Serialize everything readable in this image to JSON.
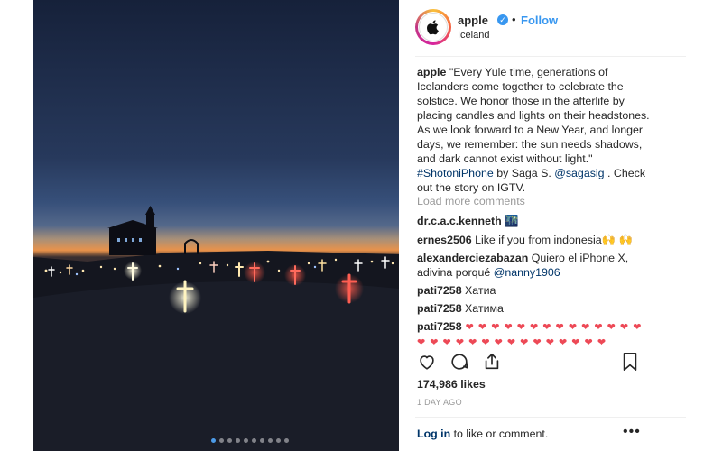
{
  "post": {
    "username": "apple",
    "verified_mark": "✓",
    "bullet": "•",
    "follow_label": "Follow",
    "location": "Iceland",
    "caption": {
      "user": "apple",
      "text": "\"Every Yule time, generations of Icelanders come together to celebrate the solstice. We honor those in the afterlife by placing candles and lights on their headstones. As we look forward to a New Year, and longer days, we remember: the sun needs shadows, and dark cannot exist without light.\" ",
      "hashtag": "#ShotoniPhone",
      "by_text": " by Saga S. ",
      "mention": "@sagasig",
      "tail": " . Check out the story on IGTV."
    },
    "load_more": "Load more comments",
    "comments": [
      {
        "user": "dr.c.a.c.kenneth",
        "text": " 🌃"
      },
      {
        "user": "ernes2506",
        "text": " Like if you from indonesia🙌 🙌"
      },
      {
        "user": "alexanderciezabazan",
        "text": " Quiero el iPhone X, adivina porqué ",
        "mention": "@nanny1906"
      },
      {
        "user": "pati7258",
        "text": " Хатиа"
      },
      {
        "user": "pati7258",
        "text": " Хатима"
      },
      {
        "user": "pati7258",
        "hearts_line1": " ❤ ❤ ❤ ❤ ❤ ❤ ❤ ❤ ❤ ❤ ❤ ❤ ❤ ❤",
        "hearts_line2": "❤ ❤ ❤ ❤ ❤ ❤ ❤ ❤ ❤ ❤ ❤ ❤ ❤ ❤ ❤"
      }
    ],
    "likes": "174,986 likes",
    "date": "1 DAY AGO",
    "login_link": "Log in",
    "login_text": " to like or comment.",
    "more_label": "•••",
    "icons": [
      "heart-icon",
      "comment-icon",
      "share-icon",
      "bookmark-icon",
      "apple-logo-icon",
      "chevron-right-icon"
    ],
    "carousel": {
      "total_slides": 10,
      "active_slide": 1
    }
  }
}
